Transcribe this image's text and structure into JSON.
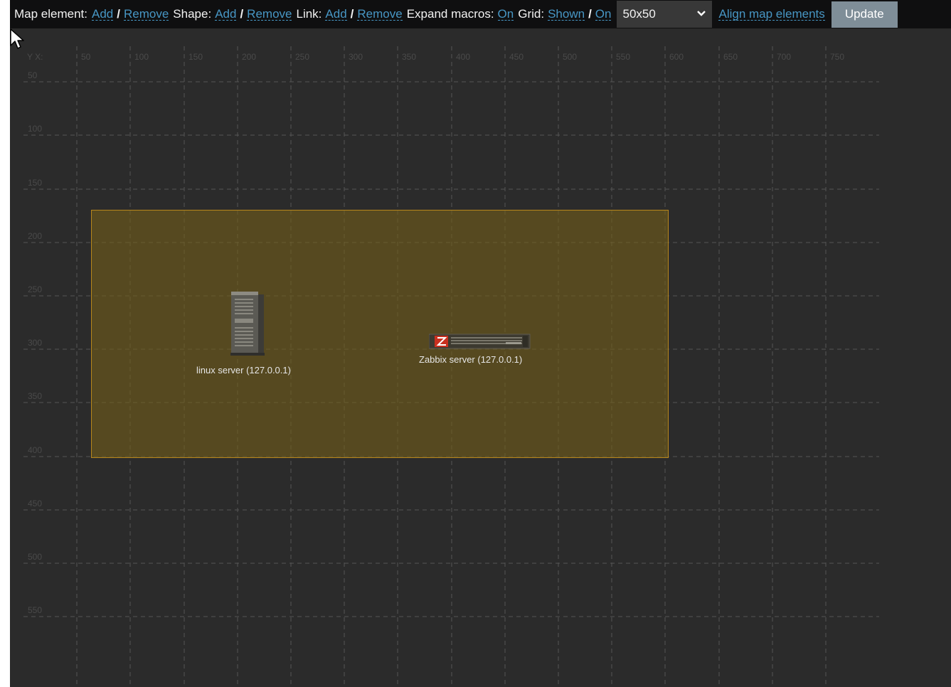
{
  "toolbar": {
    "map_element_label": "Map element:",
    "shape_label": "Shape:",
    "link_label": "Link:",
    "expand_macros_label": "Expand macros:",
    "grid_label": "Grid:",
    "add": "Add",
    "remove": "Remove",
    "separator": "/",
    "expand_macros_value": "On",
    "grid_shown": "Shown",
    "grid_auto": "On",
    "grid_size": "50x50",
    "align": "Align map elements",
    "update": "Update"
  },
  "grid": {
    "corner_label": "Y X:",
    "x_ticks": [
      "50",
      "100",
      "150",
      "200",
      "250",
      "300",
      "350",
      "400",
      "450",
      "500",
      "550",
      "600",
      "650",
      "700",
      "750"
    ],
    "y_ticks": [
      "50",
      "100",
      "150",
      "200",
      "250",
      "300",
      "350",
      "400",
      "450",
      "500",
      "550"
    ]
  },
  "elements": [
    {
      "label": "linux server (127.0.0.1)",
      "icon": "server-tower-icon"
    },
    {
      "label": "Zabbix server (127.0.0.1)",
      "icon": "zabbix-rack-server-icon"
    }
  ],
  "colors": {
    "background": "#2b2b2b",
    "toolbar": "#0f0f10",
    "link": "#4796c4",
    "shape_fill": "#735d19",
    "shape_border": "#b8871c",
    "update_button": "#7f8e98"
  }
}
